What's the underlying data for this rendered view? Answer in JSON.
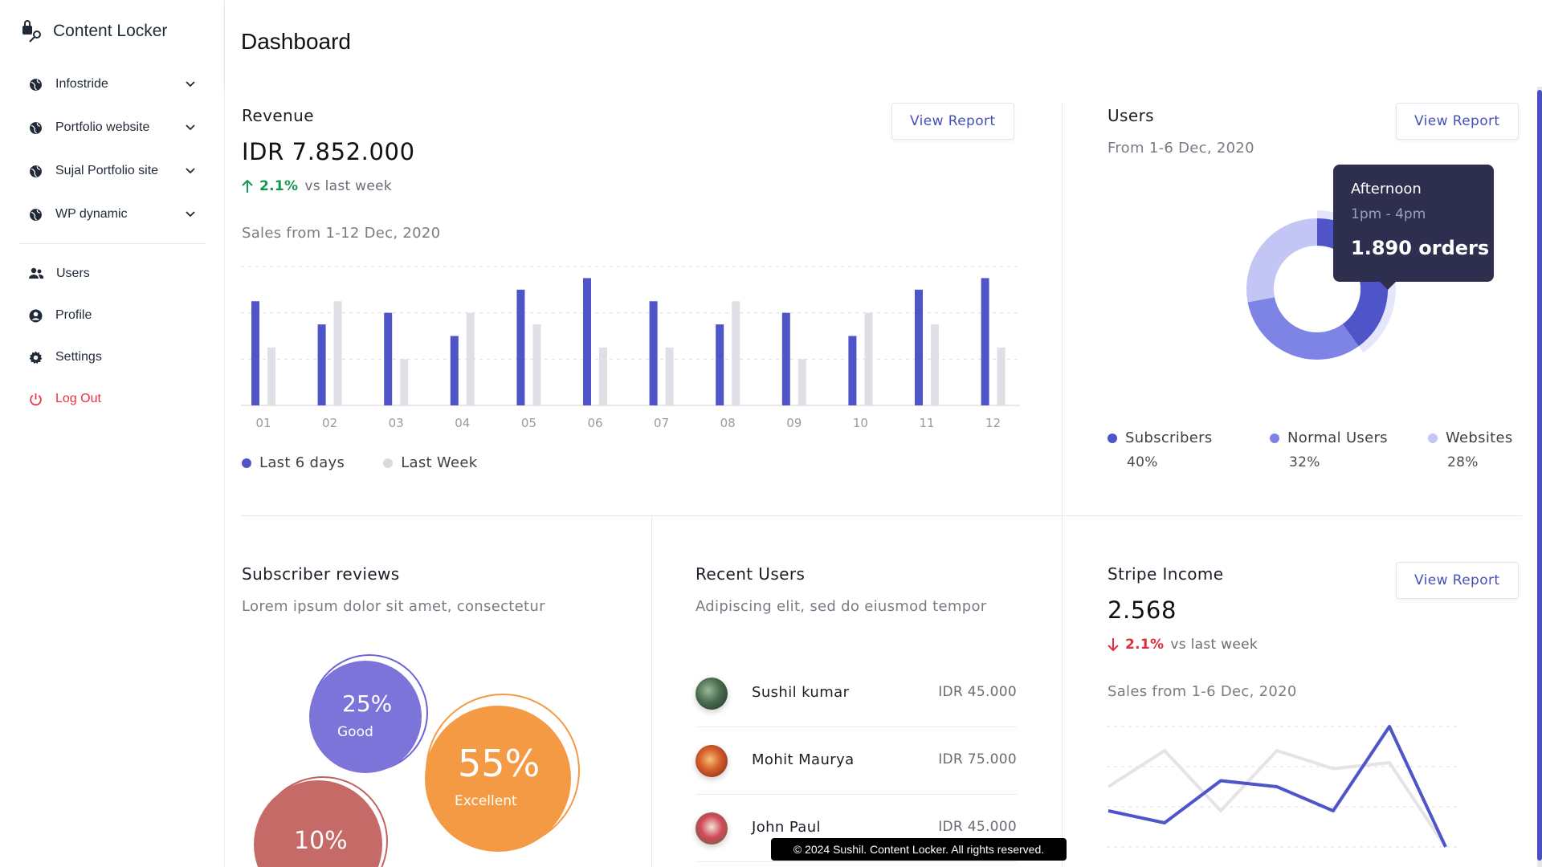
{
  "app": {
    "name": "Content Locker"
  },
  "sidebar": {
    "sites": [
      {
        "label": "Infostride"
      },
      {
        "label": "Portfolio website"
      },
      {
        "label": "Sujal Portfolio site"
      },
      {
        "label": "WP dynamic"
      }
    ],
    "menu": [
      {
        "label": "Users",
        "icon": "users-icon"
      },
      {
        "label": "Profile",
        "icon": "profile-icon"
      },
      {
        "label": "Settings",
        "icon": "gear-icon"
      },
      {
        "label": "Log Out",
        "icon": "power-icon"
      }
    ]
  },
  "header": {
    "title": "Dashboard"
  },
  "revenue": {
    "title": "Revenue",
    "button": "View Report",
    "amount": "IDR 7.852.000",
    "change": "2.1%",
    "change_text": "vs last week",
    "subtitle": "Sales from 1-12 Dec, 2020",
    "legend": [
      {
        "label": "Last 6 days",
        "color": "#4f55c8"
      },
      {
        "label": "Last Week",
        "color": "#d9dae1"
      }
    ]
  },
  "users_card": {
    "title": "Users",
    "button": "View Report",
    "subtitle": "From 1-6 Dec, 2020",
    "tooltip": {
      "title": "Afternoon",
      "time": "1pm - 4pm",
      "value": "1.890 orders"
    },
    "legend": [
      {
        "label": "Subscribers",
        "value": "40%",
        "color": "#4f55c8"
      },
      {
        "label": "Normal Users",
        "value": "32%",
        "color": "#7e84e6"
      },
      {
        "label": "Websites",
        "value": "28%",
        "color": "#c3c5f4"
      }
    ]
  },
  "reviews": {
    "title": "Subscriber reviews",
    "subtitle": "Lorem ipsum dolor sit amet, consectetur",
    "bubbles": [
      {
        "value": "25%",
        "label": "Good"
      },
      {
        "value": "55%",
        "label": "Excellent"
      },
      {
        "value": "10%",
        "label": ""
      }
    ]
  },
  "recent_users": {
    "title": "Recent Users",
    "subtitle": "Adipiscing elit, sed do eiusmod tempor",
    "rows": [
      {
        "name": "Sushil kumar",
        "amount": "IDR 45.000"
      },
      {
        "name": "Mohit Maurya",
        "amount": "IDR 75.000"
      },
      {
        "name": "John Paul",
        "amount": "IDR 45.000"
      }
    ]
  },
  "stripe": {
    "title": "Stripe Income",
    "button": "View Report",
    "amount": "2.568",
    "change": "2.1%",
    "change_text": "vs last week",
    "subtitle": "Sales from 1-6 Dec, 2020"
  },
  "footer": {
    "text": "© 2024 Sushil. Content Locker. All rights reserved."
  },
  "chart_data": [
    {
      "type": "bar",
      "categories": [
        "01",
        "02",
        "03",
        "04",
        "05",
        "06",
        "07",
        "08",
        "09",
        "10",
        "11",
        "12"
      ],
      "series": [
        {
          "name": "Last 6 days",
          "values": [
            90,
            70,
            80,
            60,
            100,
            110,
            90,
            70,
            80,
            60,
            100,
            110
          ]
        },
        {
          "name": "Last Week",
          "values": [
            50,
            90,
            40,
            80,
            70,
            50,
            50,
            90,
            40,
            80,
            70,
            50
          ]
        }
      ],
      "ylim": [
        0,
        120
      ],
      "grid": true
    },
    {
      "type": "pie",
      "categories": [
        "Subscribers",
        "Normal Users",
        "Websites"
      ],
      "values": [
        40,
        32,
        28
      ]
    },
    {
      "type": "line",
      "x": [
        1,
        2,
        3,
        4,
        5,
        6,
        7
      ],
      "series": [
        {
          "values": [
            3,
            2,
            5.5,
            5,
            3,
            10,
            0
          ]
        },
        {
          "values": [
            5,
            8,
            3,
            8,
            6.5,
            7,
            0
          ]
        }
      ],
      "ylim": [
        0,
        10
      ],
      "grid": true
    }
  ]
}
